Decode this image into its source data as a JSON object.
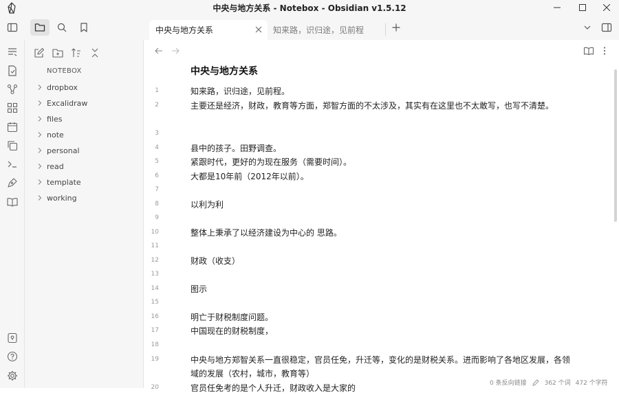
{
  "window": {
    "title": "中央与地方关系 - Notebox - Obsidian v1.5.12"
  },
  "tabs": [
    {
      "label": "中央与地方关系",
      "active": true
    },
    {
      "label": "知来路，识归途，见前程",
      "active": false
    }
  ],
  "sidebar": {
    "vault_name": "NOTEBOX",
    "folders": [
      "dropbox",
      "Excalidraw",
      "files",
      "note",
      "personal",
      "read",
      "template",
      "working"
    ]
  },
  "document": {
    "title": "中央与地方关系",
    "lines": [
      {
        "num": "1",
        "text": "知来路，识归途，见前程。"
      },
      {
        "num": "2",
        "text": "主要还是经济，财政，教育等方面，郑智方面的不太涉及，其实有在这里也不太敢写，也写不清楚。"
      },
      {
        "num": "3",
        "text": ""
      },
      {
        "num": "4",
        "text": "县中的孩子。田野调查。"
      },
      {
        "num": "5",
        "text": "紧跟时代，更好的为现在服务（需要时间）。"
      },
      {
        "num": "6",
        "text": "大都是10年前（2012年以前）。"
      },
      {
        "num": "7",
        "text": ""
      },
      {
        "num": "8",
        "text": "以利为利"
      },
      {
        "num": "9",
        "text": ""
      },
      {
        "num": "10",
        "text": "整体上秉承了以经济建设为中心的 思路。"
      },
      {
        "num": "11",
        "text": ""
      },
      {
        "num": "12",
        "text": "财政（收支）"
      },
      {
        "num": "13",
        "text": ""
      },
      {
        "num": "14",
        "text": "图示"
      },
      {
        "num": "15",
        "text": ""
      },
      {
        "num": "16",
        "text": "明亡于财税制度问题。"
      },
      {
        "num": "17",
        "text": "中国现在的财税制度，"
      },
      {
        "num": "18",
        "text": ""
      },
      {
        "num": "19",
        "text": "中央与地方郑智关系一直很稳定，官员任免，升迁等，变化的是财税关系。进而影响了各地区发展，各领域的发展（农村，城市，教育等）"
      },
      {
        "num": "20",
        "text": "官员任免考的是个人升迁，财政收入是大家的"
      }
    ]
  },
  "status": {
    "backlinks": "0 条反向链接",
    "words": "362 个词",
    "chars": "472 个字符"
  }
}
